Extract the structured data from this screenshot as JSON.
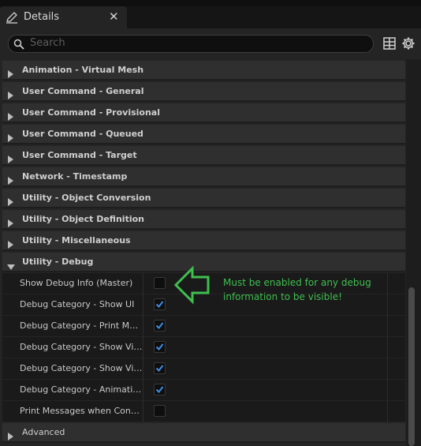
{
  "tab": {
    "title": "Details",
    "close": "✕",
    "icon": "edit-pencil-icon"
  },
  "search": {
    "placeholder": "Search"
  },
  "toolbar": {
    "table_icon": "table-view-icon",
    "settings_icon": "gear-icon"
  },
  "categories_top": [
    {
      "label": "Animation - Virtual Mesh",
      "expanded": false
    },
    {
      "label": "User Command - General",
      "expanded": false
    },
    {
      "label": "User Command - Provisional",
      "expanded": false
    },
    {
      "label": "User Command - Queued",
      "expanded": false
    },
    {
      "label": "User Command - Target",
      "expanded": false
    },
    {
      "label": "Network - Timestamp",
      "expanded": false
    },
    {
      "label": "Utility - Object Conversion",
      "expanded": false
    },
    {
      "label": "Utility - Object Definition",
      "expanded": false
    },
    {
      "label": "Utility - Miscellaneous",
      "expanded": false
    }
  ],
  "debug_category": {
    "label": "Utility - Debug",
    "expanded": true
  },
  "debug_props": [
    {
      "label": "Show Debug Info (Master)",
      "checked": false
    },
    {
      "label": "Debug  Category - Show UI",
      "checked": true
    },
    {
      "label": "Debug  Category - Print Messages",
      "checked": true
    },
    {
      "label": "Debug  Category - Show Virtual Mesh",
      "checked": true
    },
    {
      "label": "Debug  Category - Show Virtual Target",
      "checked": true
    },
    {
      "label": "Debug  Category - Animation Debug",
      "checked": true
    },
    {
      "label": "Print Messages when Continuous",
      "checked": false
    }
  ],
  "advanced_category": {
    "label": "Advanced",
    "expanded": false
  },
  "annotation": {
    "text": "Must be enabled for any debug information to be visible!",
    "color": "#3fbf4e"
  },
  "colors": {
    "checkbox_check": "#3d8ee6",
    "panel": "#242424"
  }
}
